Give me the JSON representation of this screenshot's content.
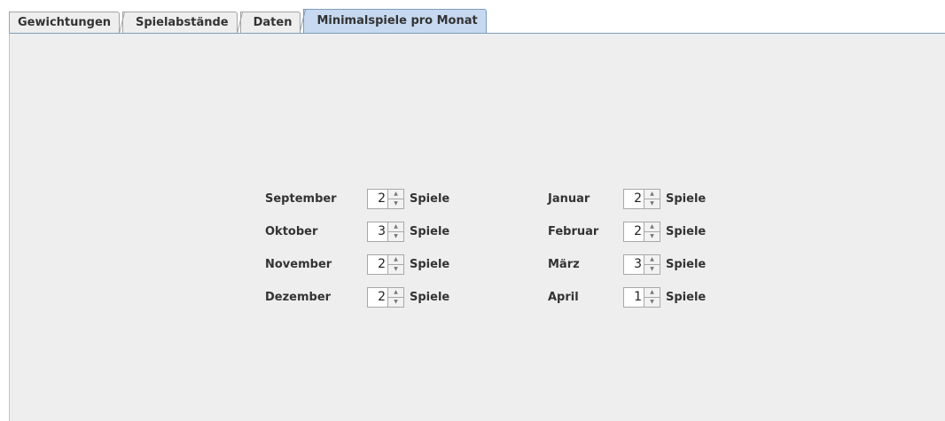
{
  "tabs": [
    {
      "label": "Gewichtungen",
      "selected": false
    },
    {
      "label": "Spielabstände",
      "selected": false
    },
    {
      "label": "Daten",
      "selected": false
    },
    {
      "label": "Minimalspiele pro Monat",
      "selected": true
    }
  ],
  "unit_label": "Spiele",
  "months_left": [
    {
      "month": "September",
      "value": "2"
    },
    {
      "month": "Oktober",
      "value": "3"
    },
    {
      "month": "November",
      "value": "2"
    },
    {
      "month": "Dezember",
      "value": "2"
    }
  ],
  "months_right": [
    {
      "month": "Januar",
      "value": "2"
    },
    {
      "month": "Februar",
      "value": "2"
    },
    {
      "month": "März",
      "value": "3"
    },
    {
      "month": "April",
      "value": "1"
    }
  ],
  "icons": {
    "spinner_up": "arrow-up-icon",
    "spinner_down": "arrow-down-icon"
  },
  "colors": {
    "selected_tab": "#c6d9f0",
    "panel_background": "#eeeeee"
  }
}
